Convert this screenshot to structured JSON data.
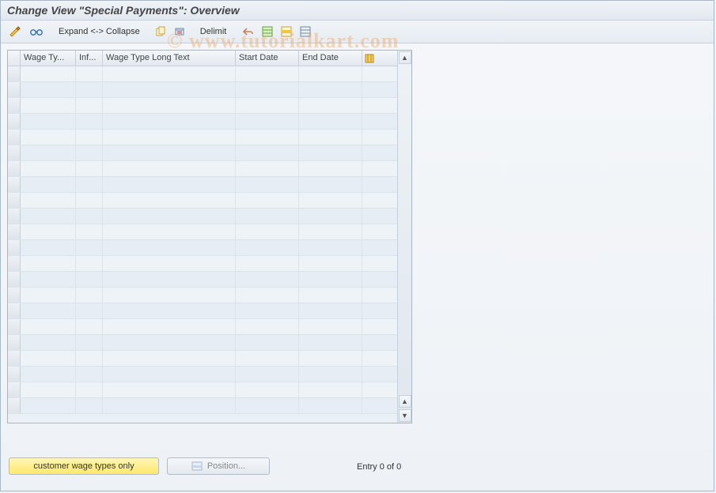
{
  "title": "Change View \"Special Payments\": Overview",
  "toolbar": {
    "expand_collapse": "Expand <-> Collapse",
    "delimit": "Delimit"
  },
  "table": {
    "columns": {
      "wage_type": "Wage Ty...",
      "inf": "Inf...",
      "long_text": "Wage Type Long Text",
      "start_date": "Start Date",
      "end_date": "End Date"
    },
    "row_count": 22
  },
  "footer": {
    "customer_wage_types": "customer wage types only",
    "position": "Position...",
    "entry_text": "Entry 0 of 0"
  },
  "watermark": "© www.tutorialkart.com"
}
